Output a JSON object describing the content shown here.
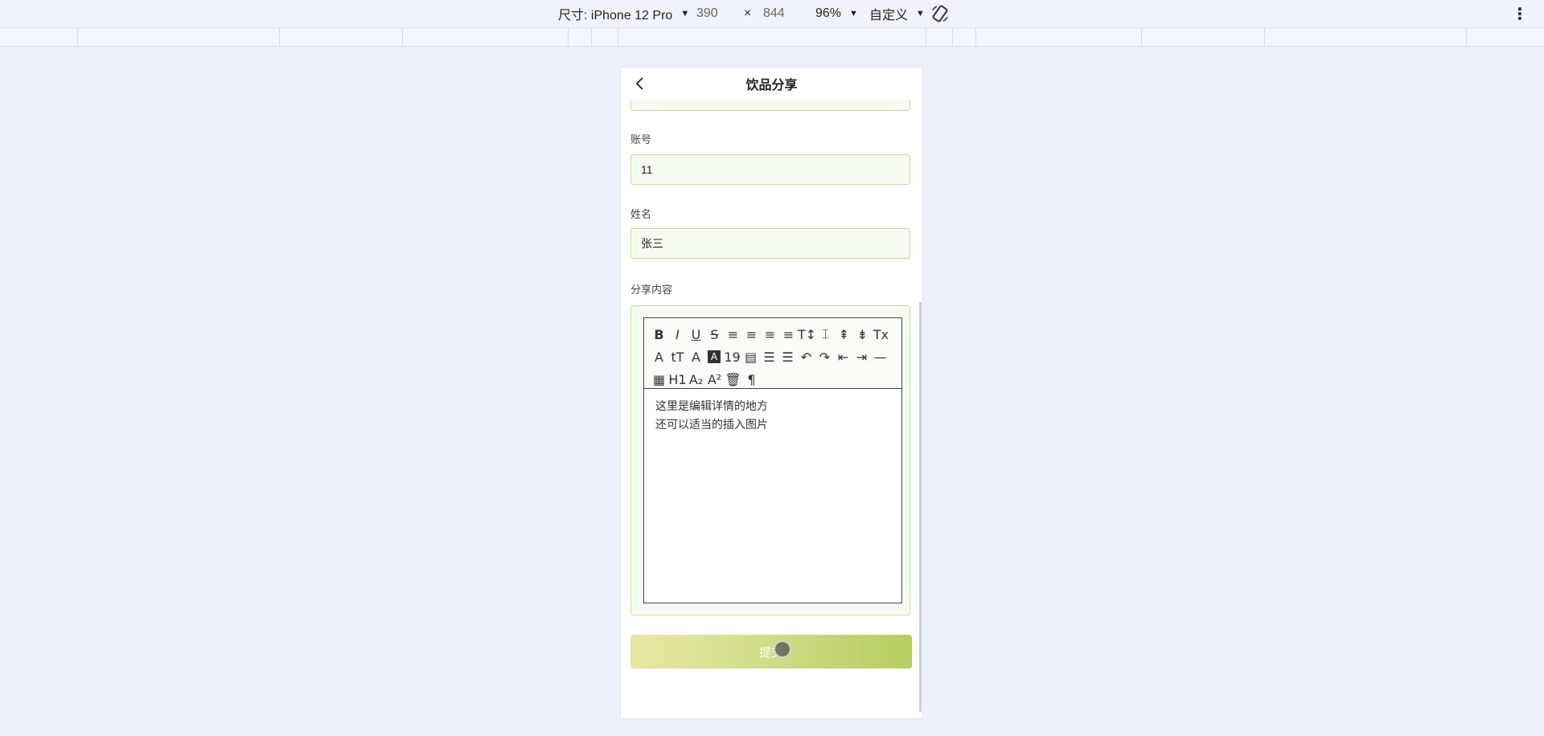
{
  "devtools": {
    "device_label": "尺寸: iPhone 12 Pro",
    "width": "390",
    "times": "×",
    "height": "844",
    "zoom": "96%",
    "mode": "自定义",
    "rotate_icon": "rotate-icon",
    "more_icon": "more-vertical-icon"
  },
  "page": {
    "title": "饮品分享",
    "back_icon": "chevron-left-icon"
  },
  "form": {
    "account_label": "账号",
    "account_value": "11",
    "name_label": "姓名",
    "name_value": "张三",
    "content_label": "分享内容",
    "content_lines": [
      "这里是编辑详情的地方",
      "还可以适当的插入图片"
    ],
    "submit_label": "提交"
  },
  "toolbar_row1": [
    "B",
    "I",
    "U",
    "S",
    "≡",
    "≡",
    "≡",
    "≡",
    "T↕",
    "⌶",
    "⇞",
    "⇟",
    "Tx"
  ],
  "toolbar_row2": [
    "A",
    "tT",
    "A",
    "A",
    "19",
    "▤",
    "☰",
    "☰",
    "↶",
    "↷",
    "⇤",
    "⇥",
    "—"
  ],
  "toolbar_row3": [
    "▦",
    "H1",
    "A₂",
    "A²",
    "🗑",
    "¶"
  ],
  "colors": {
    "accent_light": "#e8e8a4",
    "accent_dark": "#b5cd5e",
    "field_border": "#c6dd9a",
    "page_bg": "#ecf0f9"
  }
}
